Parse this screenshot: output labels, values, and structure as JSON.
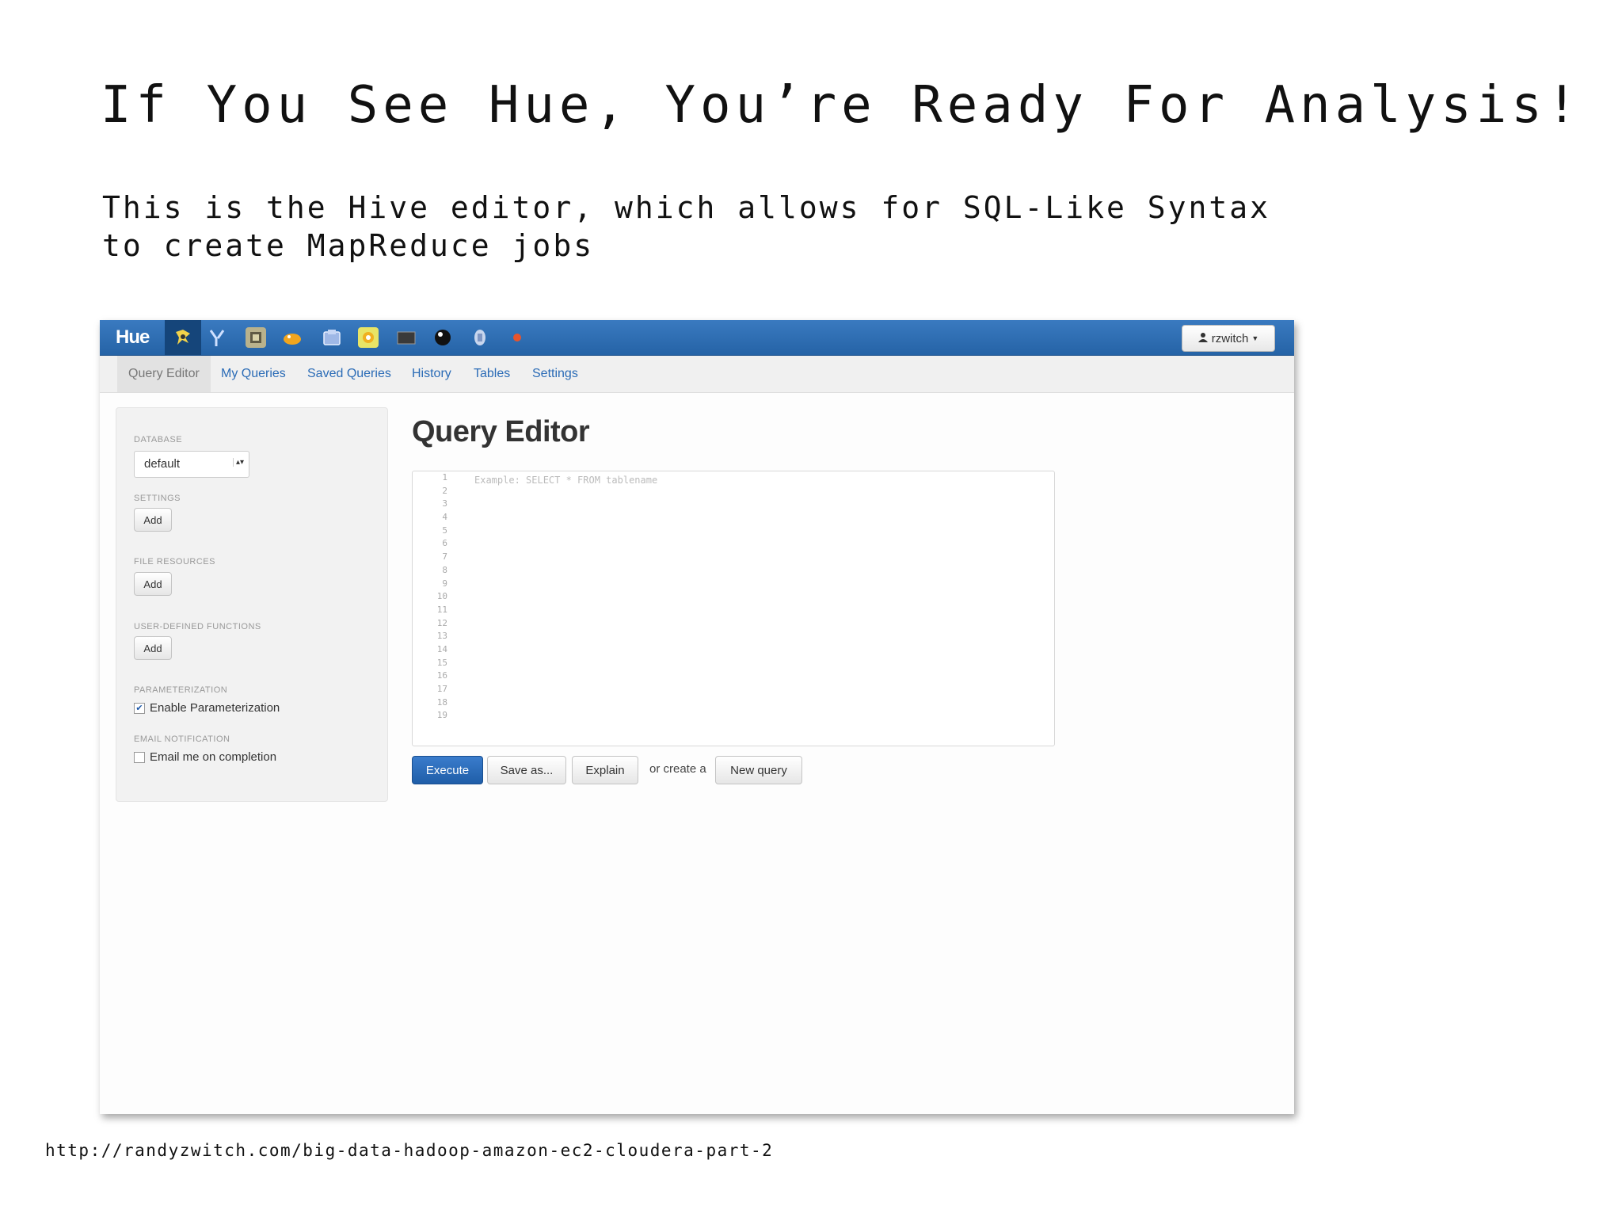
{
  "slide": {
    "title": "If You See Hue, You’re Ready For Analysis!",
    "subtitle": "This is the Hive editor, which allows for SQL-Like Syntax to create MapReduce jobs",
    "footer_url": "http://randyzwitch.com/big-data-hadoop-amazon-ec2-cloudera-part-2"
  },
  "hue": {
    "brand": "Hue",
    "app_icons": [
      "beeswax-icon",
      "pig-icon",
      "sqoop-icon",
      "oozie-icon",
      "file-browser-icon",
      "job-browser-icon",
      "shell-icon",
      "help-icon",
      "settings-icon",
      "notification-dot-icon"
    ],
    "user_button": "rzwitch",
    "tabs": [
      "Query Editor",
      "My Queries",
      "Saved Queries",
      "History",
      "Tables",
      "Settings"
    ],
    "sidebar": {
      "database_label": "DATABASE",
      "database_value": "default",
      "settings_label": "SETTINGS",
      "file_resources_label": "FILE RESOURCES",
      "udf_label": "USER-DEFINED FUNCTIONS",
      "add_label": "Add",
      "parameterization_label": "PARAMETERIZATION",
      "enable_parameterization": "Enable Parameterization",
      "enable_parameterization_checked": true,
      "email_label": "EMAIL NOTIFICATION",
      "email_option": "Email me on completion",
      "email_checked": false
    },
    "editor": {
      "title": "Query Editor",
      "placeholder": "Example: SELECT * FROM tablename",
      "line_numbers": [
        "1",
        "2",
        "3",
        "4",
        "5",
        "6",
        "7",
        "8",
        "9",
        "10",
        "11",
        "12",
        "13",
        "14",
        "15",
        "16",
        "17",
        "18",
        "19"
      ]
    },
    "actions": {
      "execute": "Execute",
      "save_as": "Save as...",
      "explain": "Explain",
      "or_create": "or create a",
      "new_query": "New query"
    },
    "colors": {
      "topbar": "#2a6bb0",
      "link": "#2a6bb6",
      "primary_button": "#2563ae"
    }
  }
}
